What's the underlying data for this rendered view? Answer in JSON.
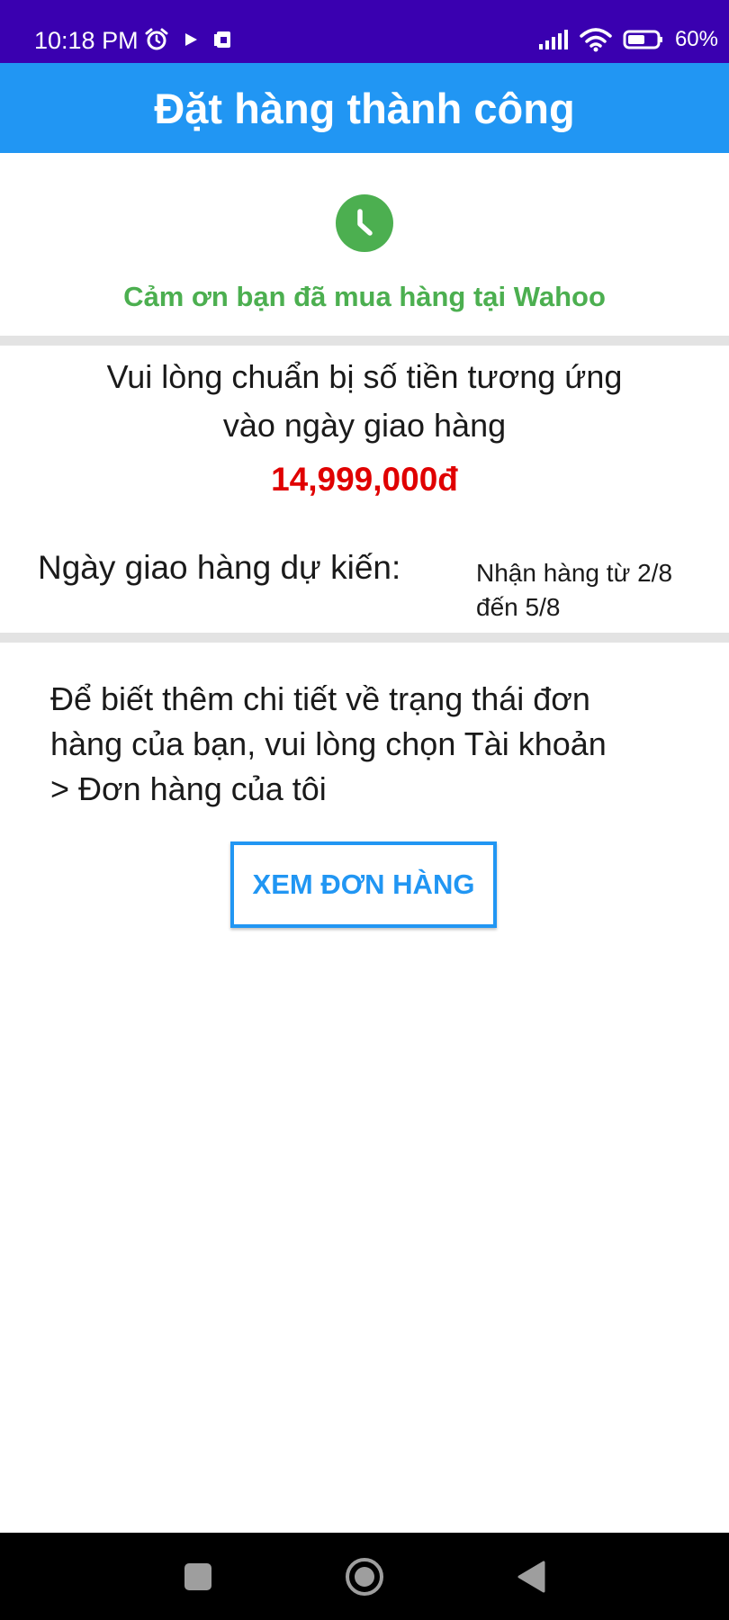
{
  "status_bar": {
    "time": "10:18 PM",
    "battery_percent": "60%",
    "icons": [
      "alarm-icon",
      "play-icon",
      "sim-card-icon",
      "signal-icon",
      "wifi-icon",
      "battery-icon"
    ]
  },
  "app_bar": {
    "title": "Đặt hàng thành công"
  },
  "confirmation": {
    "icon": "clock-icon",
    "thanks": "Cảm ơn bạn đã mua hàng tại Wahoo"
  },
  "payment": {
    "prepare_line1": "Vui lòng chuẩn bị số tiền tương ứng",
    "prepare_line2": "vào ngày giao hàng",
    "amount": "14,999,000đ"
  },
  "delivery": {
    "label": "Ngày giao hàng dự kiến:",
    "value_line1": "Nhận hàng từ 2/8",
    "value_line2": "đến 5/8"
  },
  "info": {
    "line1": "Để biết thêm chi tiết về trạng thái đơn",
    "line2": "hàng của bạn, vui lòng chọn Tài khoản",
    "line3": "> Đơn hàng của tôi"
  },
  "actions": {
    "view_orders": "XEM ĐƠN HÀNG"
  },
  "colors": {
    "status_bar": "#3a00b0",
    "app_bar": "#2196f3",
    "success_green": "#4caf50",
    "amount_red": "#e00000",
    "divider": "#e3e3e3"
  },
  "nav_bar": {
    "buttons": [
      "recents-icon",
      "home-icon",
      "back-icon"
    ]
  }
}
